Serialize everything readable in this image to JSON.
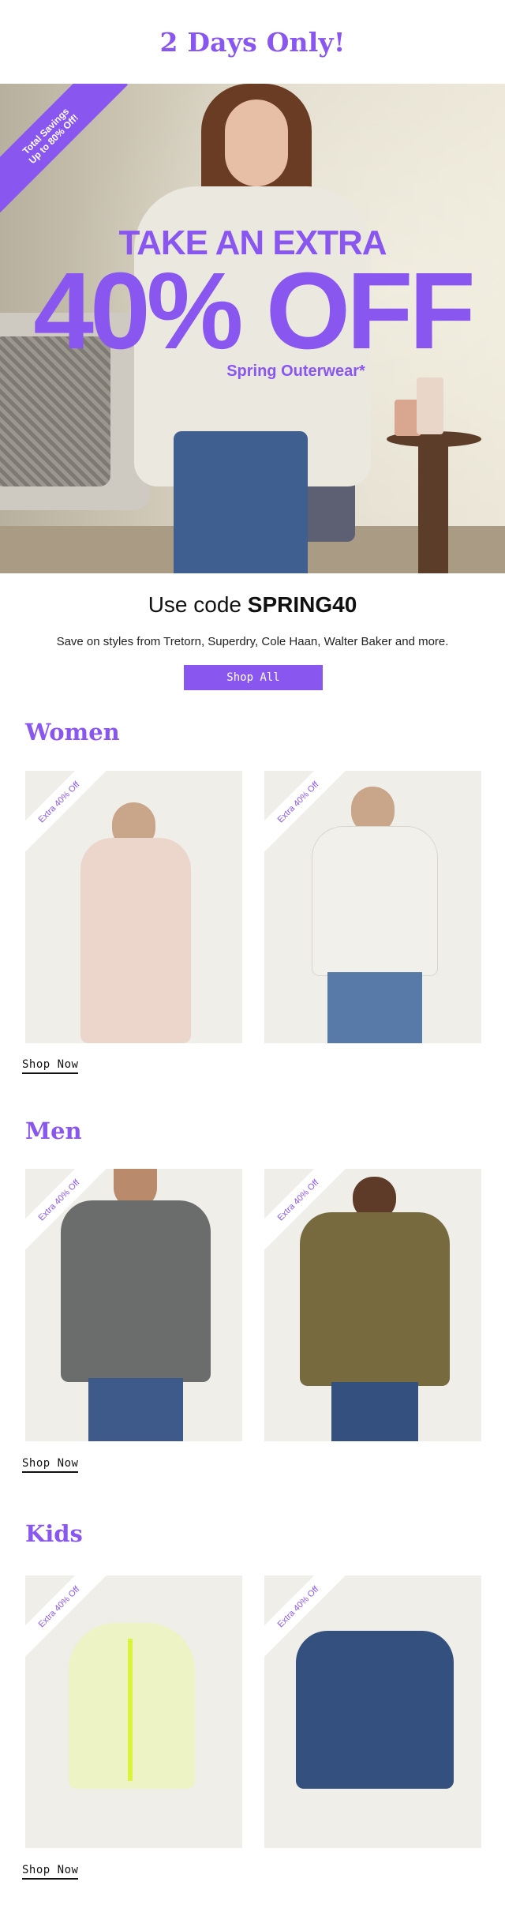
{
  "header": {
    "title": "2 Days Only!"
  },
  "hero": {
    "ribbon_line1": "Total Savings",
    "ribbon_line2": "Up to 80% Off!",
    "line1": "TAKE AN EXTRA",
    "line2": "40% OFF",
    "line3": "Spring Outerwear*"
  },
  "promo": {
    "code_prefix": "Use code ",
    "code": "SPRING40",
    "subtitle": "Save on styles from Tretorn, Superdry, Cole Haan, Walter Baker and more.",
    "shop_all_label": "Shop All"
  },
  "sections": [
    {
      "title": "Women",
      "tag": "Extra 40% Off",
      "cta": "Shop Now"
    },
    {
      "title": "Men",
      "tag": "Extra 40% Off",
      "cta": "Shop Now"
    },
    {
      "title": "Kids",
      "tag": "Extra 40% Off",
      "cta": "Shop Now"
    }
  ],
  "colors": {
    "accent": "#8a56f0",
    "text": "#111111",
    "background": "#ffffff"
  }
}
